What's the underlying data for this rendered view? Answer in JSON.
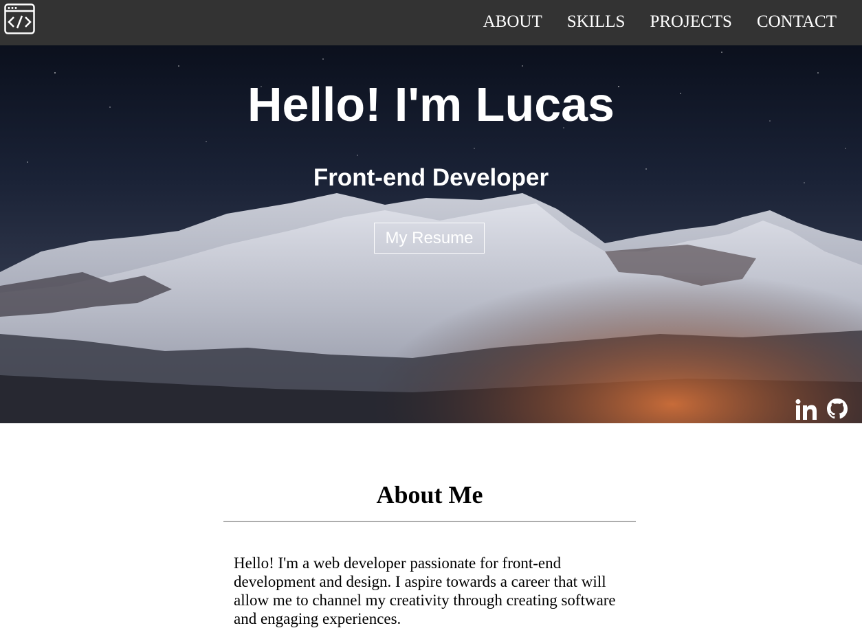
{
  "nav": {
    "logo_icon": "code-window-icon",
    "links": [
      "ABOUT",
      "SKILLS",
      "PROJECTS",
      "CONTACT"
    ]
  },
  "hero": {
    "title": "Hello! I'm Lucas",
    "subtitle": "Front-end Developer",
    "resume_button": "My Resume",
    "social": {
      "linkedin_icon": "linkedin-icon",
      "github_icon": "github-icon"
    }
  },
  "about": {
    "title": "About Me",
    "text": "Hello! I'm a web developer passionate for front-end development and design. I aspire towards a career that will allow me to channel my creativity through creating software and engaging experiences."
  },
  "colors": {
    "navbar": "#333333",
    "text_light": "#ffffff",
    "text_dark": "#000000"
  }
}
